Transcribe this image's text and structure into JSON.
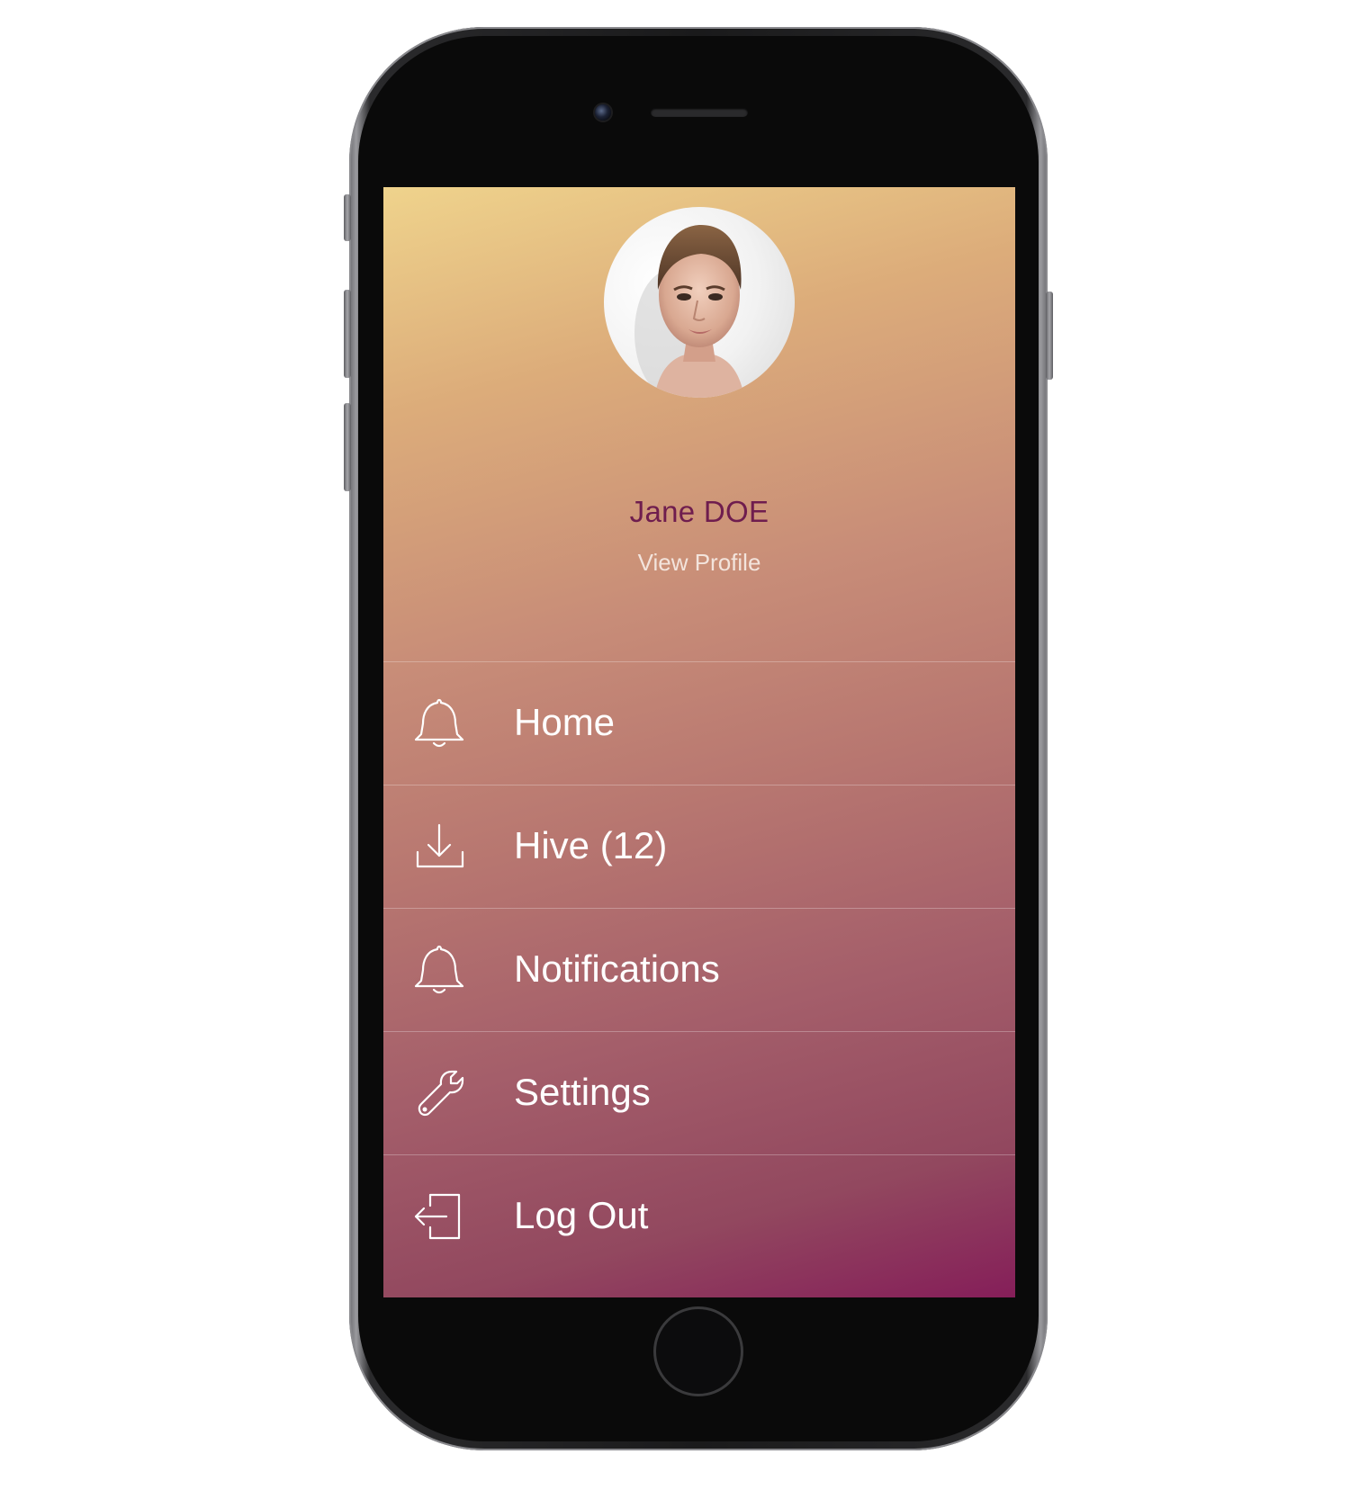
{
  "profile": {
    "name": "Jane DOE",
    "link_label": "View Profile"
  },
  "menu": {
    "items": [
      {
        "label": "Home",
        "icon": "bell-icon"
      },
      {
        "label": "Hive (12)",
        "icon": "download-icon"
      },
      {
        "label": "Notifications",
        "icon": "bell-icon"
      },
      {
        "label": "Settings",
        "icon": "wrench-icon"
      },
      {
        "label": "Log Out",
        "icon": "logout-icon"
      }
    ]
  },
  "colors": {
    "gradient_top": "#efd38c",
    "gradient_bottom": "#851e59",
    "name_text": "#6f1d4e",
    "menu_text": "#ffffff"
  }
}
